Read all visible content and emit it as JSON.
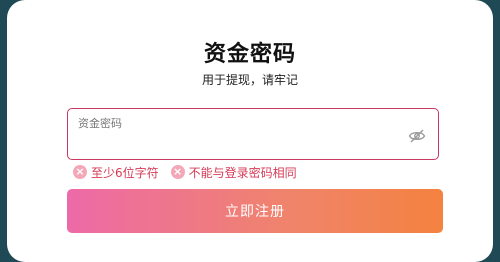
{
  "dialog": {
    "title": "资金密码",
    "subtitle": "用于提现，请牢记"
  },
  "password_field": {
    "placeholder": "资金密码",
    "value": "",
    "toggle_icon": "eye-off-icon",
    "border_color": "#c83a62"
  },
  "validation_errors": [
    {
      "icon": "error-x-icon",
      "text": "至少6位字符"
    },
    {
      "icon": "error-x-icon",
      "text": "不能与登录密码相同"
    }
  ],
  "submit": {
    "label": "立即注册",
    "gradient_start": "#ed6aa8",
    "gradient_end": "#f4823f"
  },
  "colors": {
    "error": "#d63a57",
    "backdrop": "#1f4a55"
  }
}
